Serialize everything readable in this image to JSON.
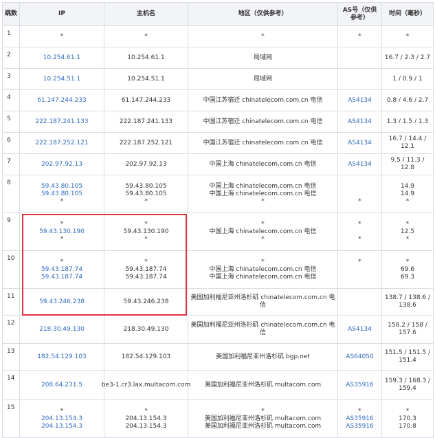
{
  "headers": {
    "hop": "跳数",
    "ip": "IP",
    "host": "主机名",
    "region": "地区（仅供参考）",
    "as": "AS号（仅供参考）",
    "time": "时间（毫秒）"
  },
  "rows": [
    {
      "hop": "1",
      "ip": [
        "*"
      ],
      "host": [
        "*"
      ],
      "region": [
        "*"
      ],
      "as": [
        "*"
      ],
      "time": [
        "*"
      ]
    },
    {
      "hop": "2",
      "ip": [
        "10.254.61.1"
      ],
      "host": [
        "10.254.61.1"
      ],
      "region": [
        "局域网"
      ],
      "as": [
        ""
      ],
      "time": [
        "16.7 / 2.3 / 2.7"
      ]
    },
    {
      "hop": "3",
      "ip": [
        "10.254.51.1"
      ],
      "host": [
        "10.254.51.1"
      ],
      "region": [
        "局域网"
      ],
      "as": [
        ""
      ],
      "time": [
        "1 / 0.9 / 1"
      ]
    },
    {
      "hop": "4",
      "ip": [
        "61.147.244.233"
      ],
      "host": [
        "61.147.244.233"
      ],
      "region": [
        "中国江苏宿迁 chinatelecom.com.cn 电信"
      ],
      "as": [
        "AS4134"
      ],
      "time": [
        "0.8 / 4.6 / 2.7"
      ]
    },
    {
      "hop": "5",
      "ip": [
        "222.187.241.133"
      ],
      "host": [
        "222.187.241.133"
      ],
      "region": [
        "中国江苏宿迁 chinatelecom.com.cn 电信"
      ],
      "as": [
        "AS4134"
      ],
      "time": [
        "1.3 / 1.5 / 1.3"
      ]
    },
    {
      "hop": "6",
      "ip": [
        "222.187.252.121"
      ],
      "host": [
        "222.187.252.121"
      ],
      "region": [
        "中国江苏宿迁 chinatelecom.com.cn 电信"
      ],
      "as": [
        "AS4134"
      ],
      "time": [
        "16.7 / 14.4 / 12.1"
      ]
    },
    {
      "hop": "7",
      "ip": [
        "202.97.92.13"
      ],
      "host": [
        "202.97.92.13"
      ],
      "region": [
        "中国上海 chinatelecom.com.cn 电信"
      ],
      "as": [
        "AS4134"
      ],
      "time": [
        "9.5 / 11.3 / 12.8"
      ]
    },
    {
      "hop": "8",
      "ip": [
        "59.43.80.105",
        "59.43.80.105",
        "*"
      ],
      "host": [
        "59.43.80.105",
        "59.43.80.105",
        "*"
      ],
      "region": [
        "中国上海 chinatelecom.com.cn 电信",
        "中国上海 chinatelecom.com.cn 电信",
        "*"
      ],
      "as": [
        "",
        "",
        "*"
      ],
      "time": [
        "14.9",
        "14.9",
        "*"
      ]
    },
    {
      "hop": "9",
      "ip": [
        "*",
        "59.43.130.190",
        "*"
      ],
      "host": [
        "*",
        "59.43.130.190",
        "*"
      ],
      "region": [
        "*",
        "中国上海 chinatelecom.com.cn 电信",
        "*"
      ],
      "as": [
        "*",
        "",
        "*"
      ],
      "time": [
        "*",
        "12.5",
        "*"
      ]
    },
    {
      "hop": "10",
      "ip": [
        "*",
        "59.43.187.74",
        "59.43.187.74"
      ],
      "host": [
        "*",
        "59.43.187.74",
        "59.43.187.74"
      ],
      "region": [
        "*",
        "中国上海 chinatelecom.com.cn 电信",
        "中国上海 chinatelecom.com.cn 电信"
      ],
      "as": [
        "*",
        "",
        ""
      ],
      "time": [
        "*",
        "69.6",
        "69.3"
      ]
    },
    {
      "hop": "11",
      "ip": [
        "59.43.246.238"
      ],
      "host": [
        "59.43.246.238"
      ],
      "region": [
        "美国加利福尼亚州洛杉矶 chinatelecom.com.cn 电信"
      ],
      "as": [
        ""
      ],
      "time": [
        "138.7 / 138.6 / 138.6"
      ]
    },
    {
      "hop": "12",
      "ip": [
        "218.30.49.130"
      ],
      "host": [
        "218.30.49.130"
      ],
      "region": [
        "美国加利福尼亚州洛杉矶 chinatelecom.com.cn 电信"
      ],
      "as": [
        "AS4134"
      ],
      "time": [
        "158.2 / 158 / 157.6"
      ]
    },
    {
      "hop": "13",
      "ip": [
        "182.54.129.103"
      ],
      "host": [
        "182.54.129.103"
      ],
      "region": [
        "美国加利福尼亚州洛杉矶 bgp.net"
      ],
      "as": [
        "AS64050"
      ],
      "time": [
        "151.5 / 151.5 / 151.4"
      ]
    },
    {
      "hop": "14",
      "ip": [
        "208.64.231.5"
      ],
      "host": [
        "be3-1.cr3.lax.multacom.com"
      ],
      "region": [
        "美国加利福尼亚州洛杉矶 multacom.com"
      ],
      "as": [
        "AS35916"
      ],
      "time": [
        "159.3 / 168.3 / 159.4"
      ]
    },
    {
      "hop": "15",
      "ip": [
        "*",
        "204.13.154.3",
        "204.13.154.3"
      ],
      "host": [
        "*",
        "204.13.154.3",
        "204.13.154.3"
      ],
      "region": [
        "*",
        "美国加利福尼亚州洛杉矶 multacom.com",
        "美国加利福尼亚州洛杉矶 multacom.com"
      ],
      "as": [
        "*",
        "AS35916",
        "AS35916"
      ],
      "time": [
        "*",
        "170.3",
        "170.8"
      ]
    }
  ],
  "highlight": {
    "color": "#e0323c",
    "from_hop": "9",
    "to_hop": "11"
  },
  "colors": {
    "link": "#2f6bbd",
    "header_bg": "#f2f4f7",
    "border": "#d9dde3"
  }
}
